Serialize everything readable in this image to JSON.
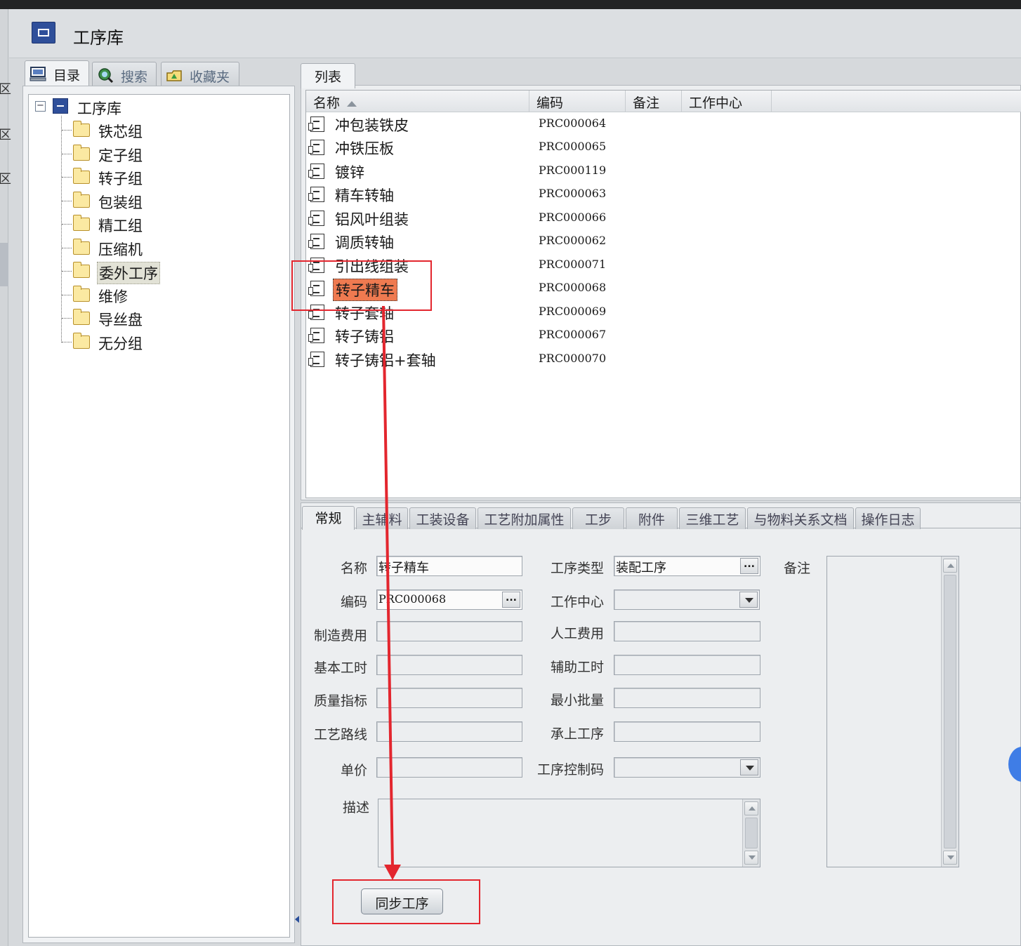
{
  "window": {
    "title": "工序库"
  },
  "left_strip": {
    "chars": [
      "区",
      "区",
      "区"
    ]
  },
  "left_tabs": [
    {
      "label": "目录",
      "icon": "monitor-icon"
    },
    {
      "label": "搜索",
      "icon": "search-globe-icon"
    },
    {
      "label": "收藏夹",
      "icon": "favorites-folder-icon"
    }
  ],
  "tree": {
    "root": "工序库",
    "items": [
      "铁芯组",
      "定子组",
      "转子组",
      "包装组",
      "精工组",
      "压缩机",
      "委外工序",
      "维修",
      "导丝盘",
      "无分组"
    ],
    "selected": "委外工序"
  },
  "list": {
    "tab_label": "列表",
    "columns": [
      "名称",
      "编码",
      "备注",
      "工作中心"
    ],
    "rows": [
      {
        "name": "冲包装铁皮",
        "code": "PRC000064"
      },
      {
        "name": "冲铁压板",
        "code": "PRC000065"
      },
      {
        "name": "镀锌",
        "code": "PRC000119"
      },
      {
        "name": "精车转轴",
        "code": "PRC000063"
      },
      {
        "name": "铝风叶组装",
        "code": "PRC000066"
      },
      {
        "name": "调质转轴",
        "code": "PRC000062"
      },
      {
        "name": "引出线组装",
        "code": "PRC000071"
      },
      {
        "name": "转子精车",
        "code": "PRC000068"
      },
      {
        "name": "转子套轴",
        "code": "PRC000069"
      },
      {
        "name": "转子铸铝",
        "code": "PRC000067"
      },
      {
        "name": "转子铸铝+套轴",
        "code": "PRC000070"
      }
    ],
    "selected_index": 7
  },
  "detail_tabs": [
    "常规",
    "主辅料",
    "工装设备",
    "工艺附加属性",
    "工步",
    "附件",
    "三维工艺",
    "与物料关系文档",
    "操作日志"
  ],
  "form": {
    "name_label": "名称",
    "name_value": "转子精车",
    "code_label": "编码",
    "code_value": "PRC000068",
    "mfg_cost_label": "制造费用",
    "base_hours_label": "基本工时",
    "quality_label": "质量指标",
    "route_label": "工艺路线",
    "price_label": "单价",
    "desc_label": "描述",
    "type_label": "工序类型",
    "type_value": "装配工序",
    "workcenter_label": "工作中心",
    "labor_cost_label": "人工费用",
    "aux_hours_label": "辅助工时",
    "min_batch_label": "最小批量",
    "prev_proc_label": "承上工序",
    "control_code_label": "工序控制码",
    "remark_label": "备注",
    "dots": "..."
  },
  "sync_button": "同步工序",
  "annotation_color": "#e3262e",
  "selection_color": "#ef7a50"
}
